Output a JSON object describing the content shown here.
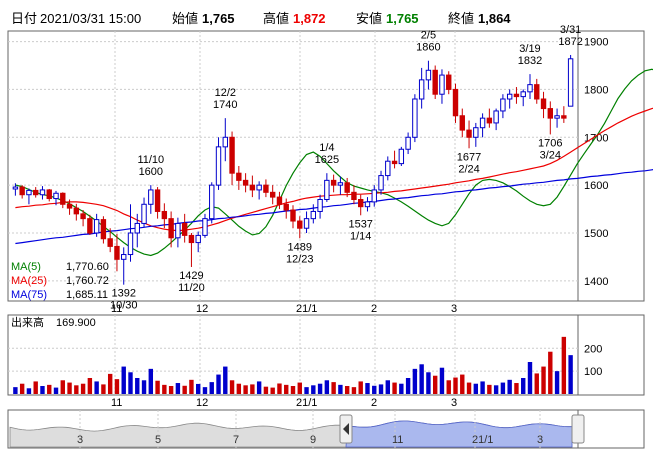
{
  "header": {
    "date_label": "日付",
    "date_value": "2021/03/31 15:00",
    "open_label": "始値",
    "open_value": "1,765",
    "high_label": "高値",
    "high_value": "1,872",
    "low_label": "安値",
    "low_value": "1,765",
    "close_label": "終値",
    "close_value": "1,864"
  },
  "colors": {
    "up": "#0000cc",
    "down": "#cc0000",
    "ma5": "#008000",
    "ma25": "#ee0000",
    "ma75": "#0000dd",
    "high_value": "#ee0000",
    "low_value": "#008000",
    "frame": "#666666",
    "grid": "#cccccc",
    "overview_fill": "#aab8ee"
  },
  "chart_data": [
    {
      "type": "candlestick",
      "ylim": [
        1360,
        1920
      ],
      "y_ticks": [
        "1400",
        "1500",
        "1600",
        "1700",
        "1800",
        "1900"
      ],
      "x_ticks": [
        "11",
        "12",
        "21/1",
        "2",
        "3"
      ],
      "legend_position": "bottom-left",
      "legend": [
        {
          "label": "MA(5)",
          "value": "1,770.60"
        },
        {
          "label": "MA(25)",
          "value": "1,760.72"
        },
        {
          "label": "MA(75)",
          "value": "1,685.11"
        }
      ],
      "annotations": [
        {
          "date": "10/30",
          "lines": [
            "1392",
            "10/30"
          ]
        },
        {
          "date": "11/10",
          "lines": [
            "11/10",
            "1600"
          ]
        },
        {
          "date": "11/20",
          "lines": [
            "1429",
            "11/20"
          ]
        },
        {
          "date": "12/2",
          "lines": [
            "12/2",
            "1740"
          ]
        },
        {
          "date": "12/23",
          "lines": [
            "1489",
            "12/23"
          ]
        },
        {
          "date": "1/4",
          "lines": [
            "1/4",
            "1625"
          ]
        },
        {
          "date": "1/14",
          "lines": [
            "1537",
            "1/14"
          ]
        },
        {
          "date": "2/5",
          "lines": [
            "2/5",
            "1860"
          ]
        },
        {
          "date": "2/24",
          "lines": [
            "1677",
            "2/24"
          ]
        },
        {
          "date": "3/19",
          "lines": [
            "3/19",
            "1832"
          ]
        },
        {
          "date": "3/24",
          "lines": [
            "1706",
            "3/24"
          ]
        },
        {
          "date": "3/31",
          "lines": [
            "3/31",
            "1872"
          ]
        }
      ],
      "series": [
        {
          "name": "MA(5)",
          "values": [
            1600,
            1597,
            1591,
            1585,
            1580,
            1578,
            1573,
            1568,
            1561,
            1553,
            1545,
            1535,
            1525,
            1514,
            1503,
            1491,
            1480,
            1470,
            1462,
            1456,
            1453,
            1458,
            1468,
            1480,
            1493,
            1506,
            1520,
            1536,
            1548,
            1555,
            1552,
            1540,
            1527,
            1514,
            1504,
            1496,
            1499,
            1513,
            1537,
            1568,
            1599,
            1625,
            1647,
            1664,
            1669,
            1660,
            1645,
            1630,
            1617,
            1605,
            1598,
            1594,
            1590,
            1587,
            1584,
            1580,
            1573,
            1565,
            1556,
            1546,
            1536,
            1527,
            1520,
            1515,
            1520,
            1538,
            1560,
            1582,
            1600,
            1610,
            1612,
            1610,
            1605,
            1597,
            1588,
            1577,
            1567,
            1560,
            1557,
            1560,
            1575,
            1597,
            1621,
            1645,
            1666,
            1686,
            1706,
            1729,
            1755,
            1781,
            1801,
            1818,
            1830,
            1839,
            1842,
            1838,
            1826,
            1807,
            1788,
            1768,
            1749,
            1733,
            1722,
            1715,
            1712,
            1715,
            1720,
            1726,
            1732,
            1738,
            1745,
            1752,
            1760,
            1770,
            1780,
            1790,
            1800,
            1808,
            1810,
            1795,
            1772,
            1752,
            1744,
            1751,
            1768
          ]
        },
        {
          "name": "MA(25)",
          "values": [
            1553,
            1555,
            1556,
            1558,
            1559,
            1561,
            1562,
            1564,
            1565,
            1565,
            1564,
            1562,
            1560,
            1557,
            1552,
            1547,
            1540,
            1534,
            1527,
            1521,
            1515,
            1511,
            1508,
            1506,
            1505,
            1506,
            1508,
            1510,
            1513,
            1517,
            1521,
            1526,
            1531,
            1535,
            1539,
            1543,
            1547,
            1551,
            1555,
            1559,
            1563,
            1566,
            1570,
            1573,
            1575,
            1577,
            1578,
            1579,
            1580,
            1580,
            1581,
            1581,
            1582,
            1583,
            1584,
            1585,
            1587,
            1588,
            1590,
            1592,
            1594,
            1596,
            1598,
            1600,
            1602,
            1605,
            1607,
            1609,
            1612,
            1614,
            1617,
            1620,
            1623,
            1626,
            1628,
            1631,
            1634,
            1637,
            1640,
            1645,
            1652,
            1660,
            1669,
            1678,
            1687,
            1696,
            1705,
            1714,
            1722,
            1730,
            1737,
            1744,
            1750,
            1755,
            1760,
            1764,
            1767,
            1769,
            1770,
            1770,
            1769,
            1767,
            1765,
            1763,
            1761,
            1759,
            1759,
            1759,
            1760,
            1762,
            1764,
            1766,
            1768,
            1770,
            1771,
            1772,
            1773,
            1773,
            1772,
            1770,
            1767,
            1764,
            1762,
            1761,
            1761
          ]
        },
        {
          "name": "MA(75)",
          "values": [
            1478,
            1480,
            1482,
            1484,
            1486,
            1488,
            1490,
            1491,
            1493,
            1495,
            1497,
            1498,
            1500,
            1502,
            1504,
            1505,
            1507,
            1509,
            1510,
            1512,
            1514,
            1515,
            1517,
            1518,
            1520,
            1522,
            1523,
            1525,
            1526,
            1528,
            1530,
            1531,
            1533,
            1534,
            1536,
            1538,
            1539,
            1541,
            1542,
            1544,
            1546,
            1547,
            1549,
            1550,
            1552,
            1554,
            1555,
            1557,
            1558,
            1560,
            1562,
            1563,
            1565,
            1566,
            1568,
            1570,
            1571,
            1573,
            1574,
            1576,
            1578,
            1579,
            1581,
            1582,
            1584,
            1586,
            1587,
            1589,
            1590,
            1592,
            1594,
            1595,
            1597,
            1598,
            1600,
            1602,
            1603,
            1605,
            1606,
            1608,
            1610,
            1611,
            1613,
            1614,
            1616,
            1618,
            1619,
            1621,
            1622,
            1624,
            1626,
            1627,
            1629,
            1630,
            1632,
            1634,
            1635,
            1637,
            1638,
            1640,
            1642,
            1643,
            1645,
            1646,
            1648,
            1650,
            1651,
            1653,
            1654,
            1656,
            1658,
            1659,
            1661,
            1662,
            1664,
            1666,
            1667,
            1669,
            1670,
            1672,
            1674,
            1675,
            1677,
            1678,
            1680
          ]
        }
      ],
      "candles_note": "open, high, low, close per trading day",
      "candles": [
        [
          1592,
          1604,
          1578,
          1596
        ],
        [
          1596,
          1600,
          1572,
          1580
        ],
        [
          1580,
          1593,
          1560,
          1589
        ],
        [
          1589,
          1596,
          1574,
          1580
        ],
        [
          1580,
          1598,
          1570,
          1590
        ],
        [
          1590,
          1592,
          1566,
          1572
        ],
        [
          1572,
          1588,
          1558,
          1583
        ],
        [
          1583,
          1585,
          1552,
          1560
        ],
        [
          1560,
          1570,
          1538,
          1552
        ],
        [
          1552,
          1561,
          1526,
          1540
        ],
        [
          1540,
          1548,
          1514,
          1530
        ],
        [
          1530,
          1538,
          1496,
          1500
        ],
        [
          1500,
          1540,
          1492,
          1528
        ],
        [
          1528,
          1535,
          1478,
          1488
        ],
        [
          1488,
          1510,
          1460,
          1472
        ],
        [
          1472,
          1498,
          1420,
          1445
        ],
        [
          1445,
          1470,
          1392,
          1455
        ],
        [
          1455,
          1560,
          1440,
          1500
        ],
        [
          1500,
          1540,
          1470,
          1520
        ],
        [
          1520,
          1574,
          1512,
          1560
        ],
        [
          1560,
          1600,
          1540,
          1590
        ],
        [
          1590,
          1596,
          1530,
          1545
        ],
        [
          1545,
          1562,
          1510,
          1530
        ],
        [
          1530,
          1545,
          1470,
          1490
        ],
        [
          1490,
          1532,
          1470,
          1520
        ],
        [
          1520,
          1540,
          1480,
          1495
        ],
        [
          1495,
          1500,
          1429,
          1480
        ],
        [
          1480,
          1503,
          1460,
          1495
        ],
        [
          1495,
          1540,
          1490,
          1530
        ],
        [
          1530,
          1606,
          1520,
          1600
        ],
        [
          1600,
          1700,
          1590,
          1680
        ],
        [
          1680,
          1740,
          1650,
          1700
        ],
        [
          1700,
          1712,
          1600,
          1625
        ],
        [
          1625,
          1640,
          1590,
          1610
        ],
        [
          1610,
          1625,
          1585,
          1600
        ],
        [
          1600,
          1620,
          1575,
          1590
        ],
        [
          1590,
          1608,
          1570,
          1600
        ],
        [
          1600,
          1612,
          1575,
          1585
        ],
        [
          1585,
          1600,
          1560,
          1575
        ],
        [
          1575,
          1586,
          1550,
          1560
        ],
        [
          1560,
          1572,
          1530,
          1548
        ],
        [
          1548,
          1558,
          1510,
          1525
        ],
        [
          1525,
          1535,
          1489,
          1510
        ],
        [
          1510,
          1545,
          1500,
          1530
        ],
        [
          1530,
          1560,
          1520,
          1545
        ],
        [
          1545,
          1580,
          1530,
          1570
        ],
        [
          1570,
          1625,
          1565,
          1610
        ],
        [
          1610,
          1622,
          1585,
          1600
        ],
        [
          1600,
          1618,
          1580,
          1605
        ],
        [
          1605,
          1615,
          1575,
          1585
        ],
        [
          1585,
          1600,
          1560,
          1570
        ],
        [
          1570,
          1580,
          1537,
          1555
        ],
        [
          1555,
          1575,
          1545,
          1565
        ],
        [
          1565,
          1600,
          1555,
          1590
        ],
        [
          1590,
          1630,
          1580,
          1620
        ],
        [
          1620,
          1660,
          1610,
          1650
        ],
        [
          1650,
          1672,
          1635,
          1645
        ],
        [
          1645,
          1680,
          1640,
          1675
        ],
        [
          1675,
          1710,
          1665,
          1700
        ],
        [
          1700,
          1790,
          1690,
          1780
        ],
        [
          1780,
          1845,
          1760,
          1820
        ],
        [
          1820,
          1860,
          1800,
          1840
        ],
        [
          1840,
          1850,
          1780,
          1790
        ],
        [
          1790,
          1842,
          1770,
          1830
        ],
        [
          1830,
          1838,
          1790,
          1800
        ],
        [
          1800,
          1812,
          1730,
          1745
        ],
        [
          1745,
          1760,
          1700,
          1715
        ],
        [
          1715,
          1735,
          1677,
          1700
        ],
        [
          1700,
          1730,
          1680,
          1720
        ],
        [
          1720,
          1750,
          1700,
          1740
        ],
        [
          1740,
          1760,
          1720,
          1730
        ],
        [
          1730,
          1760,
          1715,
          1755
        ],
        [
          1755,
          1790,
          1740,
          1780
        ],
        [
          1780,
          1800,
          1760,
          1790
        ],
        [
          1790,
          1805,
          1770,
          1785
        ],
        [
          1785,
          1800,
          1765,
          1795
        ],
        [
          1795,
          1832,
          1780,
          1810
        ],
        [
          1810,
          1822,
          1770,
          1780
        ],
        [
          1780,
          1795,
          1740,
          1760
        ],
        [
          1760,
          1775,
          1706,
          1740
        ],
        [
          1740,
          1760,
          1720,
          1745
        ],
        [
          1745,
          1765,
          1730,
          1740
        ],
        [
          1765,
          1872,
          1765,
          1864
        ]
      ],
      "candle_dates_note": "index of each labelled date",
      "date_index": {
        "10/30": 16,
        "11/10": 20,
        "11/20": 26,
        "12/2": 31,
        "12/23": 42,
        "1/4": 46,
        "1/14": 51,
        "2/5": 61,
        "2/24": 67,
        "3/19": 76,
        "3/24": 79,
        "3/31": 82
      }
    },
    {
      "type": "bar",
      "title": "出来高",
      "title_value": "169.900",
      "ylim": [
        0,
        280
      ],
      "y_ticks": [
        "100",
        "200"
      ],
      "x_ticks": [
        "11",
        "12",
        "21/1",
        "2",
        "3"
      ],
      "values": [
        30,
        45,
        25,
        55,
        35,
        40,
        28,
        60,
        50,
        38,
        45,
        70,
        55,
        42,
        88,
        65,
        120,
        95,
        70,
        60,
        110,
        58,
        40,
        35,
        48,
        36,
        62,
        44,
        30,
        52,
        85,
        120,
        60,
        45,
        38,
        42,
        55,
        32,
        28,
        46,
        40,
        35,
        50,
        30,
        38,
        45,
        60,
        52,
        40,
        35,
        30,
        55,
        48,
        36,
        42,
        60,
        50,
        45,
        70,
        110,
        130,
        95,
        80,
        115,
        60,
        72,
        85,
        50,
        45,
        55,
        40,
        38,
        50,
        62,
        48,
        70,
        140,
        90,
        120,
        185,
        100,
        250,
        170
      ]
    },
    {
      "type": "area",
      "x_ticks": [
        "3",
        "5",
        "7",
        "9",
        "11",
        "21/1",
        "3"
      ]
    }
  ]
}
